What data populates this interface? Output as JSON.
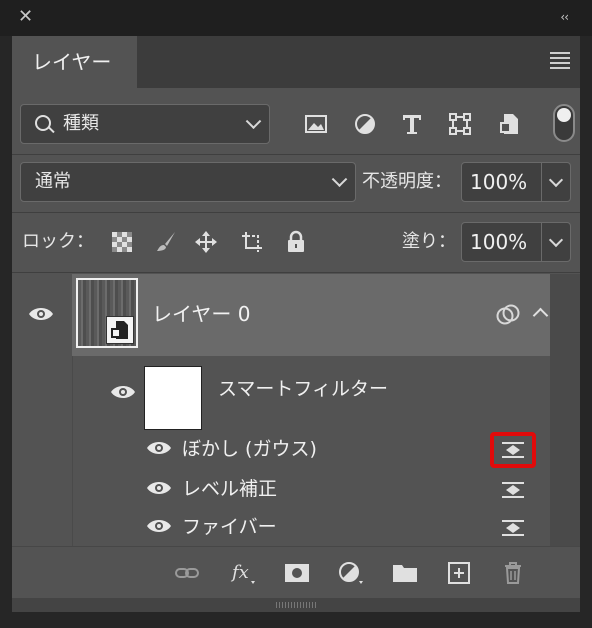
{
  "window": {
    "close_label": "✕",
    "collapse_label": "‹‹"
  },
  "panel": {
    "tab_label": "レイヤー"
  },
  "filter": {
    "kind_label": "種類"
  },
  "blend": {
    "mode": "通常",
    "opacity_label": "不透明度：",
    "opacity_value": "100%"
  },
  "lock": {
    "label": "ロック：",
    "fill_label": "塗り：",
    "fill_value": "100%"
  },
  "layers": {
    "layer0_name": "レイヤー 0",
    "smart_filter_label": "スマートフィルター",
    "filters": [
      {
        "name": "ぼかし (ガウス)",
        "highlighted": true
      },
      {
        "name": "レベル補正",
        "highlighted": false
      },
      {
        "name": "ファイバー",
        "highlighted": false
      }
    ]
  },
  "colors": {
    "highlight": "#e10b0b",
    "panel_bg": "#535353",
    "selected_layer_bg": "#6a6a6a"
  }
}
